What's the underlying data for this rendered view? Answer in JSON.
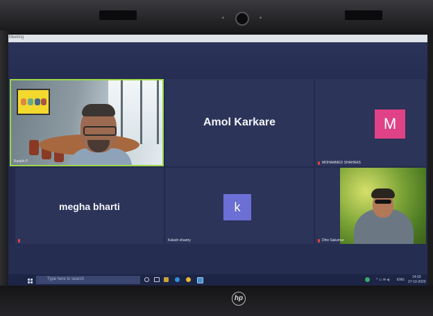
{
  "window": {
    "title": "Meeting"
  },
  "hardware": {
    "brand_logo": "hp"
  },
  "tiles": [
    {
      "label": "Ranjith P"
    },
    {
      "name": "Amol Karkare"
    },
    {
      "avatar_letter": "M",
      "avatar_color": "#e04187",
      "label": "MOHAMMED SHAHRAS"
    },
    {
      "name": "megha bharti"
    },
    {
      "avatar_letter": "k",
      "avatar_color": "#6b6fd6",
      "label": "Kalash shastry"
    },
    {
      "label": "Dhiv Sakumar"
    }
  ],
  "taskbar": {
    "search_placeholder": "Type here to search",
    "tray_text": "ENG",
    "clock_time": "14:03",
    "clock_date": "27-10-2020"
  },
  "colors": {
    "active_speaker": "#9bd84a",
    "stage": "#232a4d",
    "tile": "#2c3459"
  }
}
